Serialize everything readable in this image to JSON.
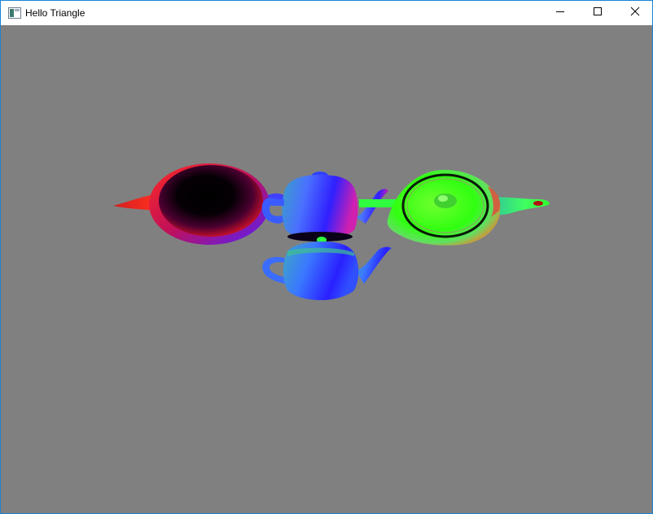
{
  "window": {
    "title": "Hello Triangle",
    "app_icon": "application-window-icon",
    "controls": {
      "minimize_icon": "minimize-icon",
      "maximize_icon": "maximize-icon",
      "close_icon": "close-icon"
    }
  },
  "viewport": {
    "clear_color": "#808080",
    "scene_objects": [
      "teapot-left-top-view",
      "teapot-center-side-view",
      "teapot-right-bottom-view",
      "teapot-front-side-view"
    ]
  }
}
